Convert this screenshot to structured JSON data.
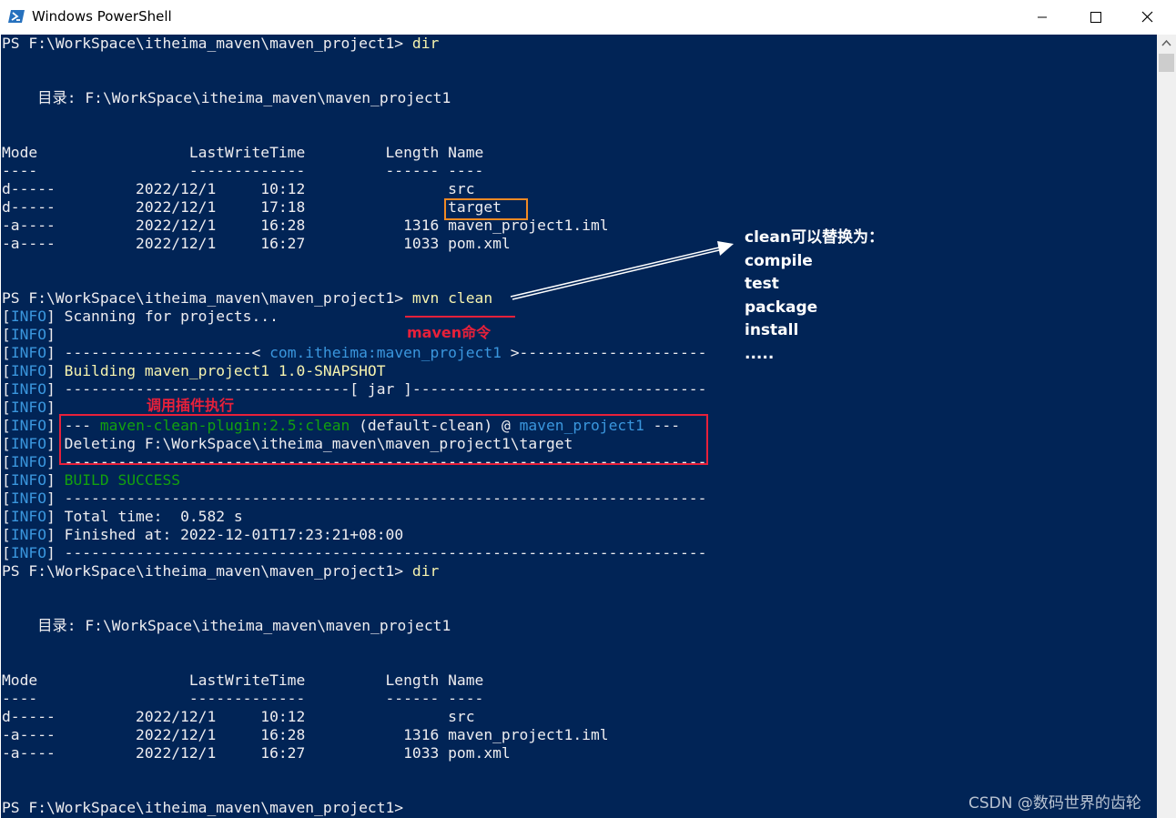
{
  "window": {
    "title": "Windows PowerShell",
    "controls": [
      "minimize-icon",
      "maximize-icon",
      "close-icon"
    ]
  },
  "colors": {
    "console_bg": "#012456",
    "default_fg": "#eeedf0",
    "yellow": "#f6f3ae",
    "cyan": "#3a96dd",
    "green": "#13a10e",
    "annotation_red": "#e8203a",
    "annotation_orange": "#f08a24"
  },
  "console": {
    "lines": [
      [
        {
          "t": "PS F:\\WorkSpace\\itheima_maven\\maven_project1> ",
          "c": "w"
        },
        {
          "t": "dir",
          "c": "y"
        }
      ],
      [],
      [],
      [
        {
          "t": "    目录: F:\\WorkSpace\\itheima_maven\\maven_project1",
          "c": "w"
        }
      ],
      [],
      [],
      [
        {
          "t": "Mode                 LastWriteTime         Length Name",
          "c": "w"
        }
      ],
      [
        {
          "t": "----                 -------------         ------ ----",
          "c": "w"
        }
      ],
      [
        {
          "t": "d-----         2022/12/1     10:12                src",
          "c": "w"
        }
      ],
      [
        {
          "t": "d-----         2022/12/1     17:18                target",
          "c": "w"
        }
      ],
      [
        {
          "t": "-a----         2022/12/1     16:28           1316 maven_project1.iml",
          "c": "w"
        }
      ],
      [
        {
          "t": "-a----         2022/12/1     16:27           1033 pom.xml",
          "c": "w"
        }
      ],
      [],
      [],
      [
        {
          "t": "PS F:\\WorkSpace\\itheima_maven\\maven_project1> ",
          "c": "w"
        },
        {
          "t": "mvn clean",
          "c": "y"
        }
      ],
      [
        {
          "t": "[",
          "c": "w"
        },
        {
          "t": "INFO",
          "c": "c"
        },
        {
          "t": "] Scanning for projects...",
          "c": "w"
        }
      ],
      [
        {
          "t": "[",
          "c": "w"
        },
        {
          "t": "INFO",
          "c": "c"
        },
        {
          "t": "]",
          "c": "w"
        }
      ],
      [
        {
          "t": "[",
          "c": "w"
        },
        {
          "t": "INFO",
          "c": "c"
        },
        {
          "t": "] ---------------------< ",
          "c": "w"
        },
        {
          "t": "com.itheima:maven_project1",
          "c": "c"
        },
        {
          "t": " >---------------------",
          "c": "w"
        }
      ],
      [
        {
          "t": "[",
          "c": "w"
        },
        {
          "t": "INFO",
          "c": "c"
        },
        {
          "t": "] ",
          "c": "w"
        },
        {
          "t": "Building maven_project1 1.0-SNAPSHOT",
          "c": "y"
        }
      ],
      [
        {
          "t": "[",
          "c": "w"
        },
        {
          "t": "INFO",
          "c": "c"
        },
        {
          "t": "] --------------------------------[ jar ]---------------------------------",
          "c": "w"
        }
      ],
      [
        {
          "t": "[",
          "c": "w"
        },
        {
          "t": "INFO",
          "c": "c"
        },
        {
          "t": "]",
          "c": "w"
        }
      ],
      [
        {
          "t": "[",
          "c": "w"
        },
        {
          "t": "INFO",
          "c": "c"
        },
        {
          "t": "] --- ",
          "c": "w"
        },
        {
          "t": "maven-clean-plugin:2.5:clean",
          "c": "g"
        },
        {
          "t": " (default-clean) @ ",
          "c": "w"
        },
        {
          "t": "maven_project1",
          "c": "c"
        },
        {
          "t": " ---",
          "c": "w"
        }
      ],
      [
        {
          "t": "[",
          "c": "w"
        },
        {
          "t": "INFO",
          "c": "c"
        },
        {
          "t": "] Deleting F:\\WorkSpace\\itheima_maven\\maven_project1\\target",
          "c": "w"
        }
      ],
      [
        {
          "t": "[",
          "c": "w"
        },
        {
          "t": "INFO",
          "c": "c"
        },
        {
          "t": "] ------------------------------------------------------------------------",
          "c": "w"
        }
      ],
      [
        {
          "t": "[",
          "c": "w"
        },
        {
          "t": "INFO",
          "c": "c"
        },
        {
          "t": "] ",
          "c": "w"
        },
        {
          "t": "BUILD SUCCESS",
          "c": "g"
        }
      ],
      [
        {
          "t": "[",
          "c": "w"
        },
        {
          "t": "INFO",
          "c": "c"
        },
        {
          "t": "] ------------------------------------------------------------------------",
          "c": "w"
        }
      ],
      [
        {
          "t": "[",
          "c": "w"
        },
        {
          "t": "INFO",
          "c": "c"
        },
        {
          "t": "] Total time:  0.582 s",
          "c": "w"
        }
      ],
      [
        {
          "t": "[",
          "c": "w"
        },
        {
          "t": "INFO",
          "c": "c"
        },
        {
          "t": "] Finished at: 2022-12-01T17:23:21+08:00",
          "c": "w"
        }
      ],
      [
        {
          "t": "[",
          "c": "w"
        },
        {
          "t": "INFO",
          "c": "c"
        },
        {
          "t": "] ------------------------------------------------------------------------",
          "c": "w"
        }
      ],
      [
        {
          "t": "PS F:\\WorkSpace\\itheima_maven\\maven_project1> ",
          "c": "w"
        },
        {
          "t": "dir",
          "c": "y"
        }
      ],
      [],
      [],
      [
        {
          "t": "    目录: F:\\WorkSpace\\itheima_maven\\maven_project1",
          "c": "w"
        }
      ],
      [],
      [],
      [
        {
          "t": "Mode                 LastWriteTime         Length Name",
          "c": "w"
        }
      ],
      [
        {
          "t": "----                 -------------         ------ ----",
          "c": "w"
        }
      ],
      [
        {
          "t": "d-----         2022/12/1     10:12                src",
          "c": "w"
        }
      ],
      [
        {
          "t": "-a----         2022/12/1     16:28           1316 maven_project1.iml",
          "c": "w"
        }
      ],
      [
        {
          "t": "-a----         2022/12/1     16:27           1033 pom.xml",
          "c": "w"
        }
      ],
      [],
      [],
      [
        {
          "t": "PS F:\\WorkSpace\\itheima_maven\\maven_project1>",
          "c": "w"
        }
      ]
    ]
  },
  "annotations": {
    "maven_command_label": "maven命令",
    "plugin_label": "调用插件执行",
    "replace_note": [
      "clean可以替换为：",
      "compile",
      "test",
      "package",
      "install",
      "....."
    ]
  },
  "watermark": "CSDN @数码世界的齿轮"
}
